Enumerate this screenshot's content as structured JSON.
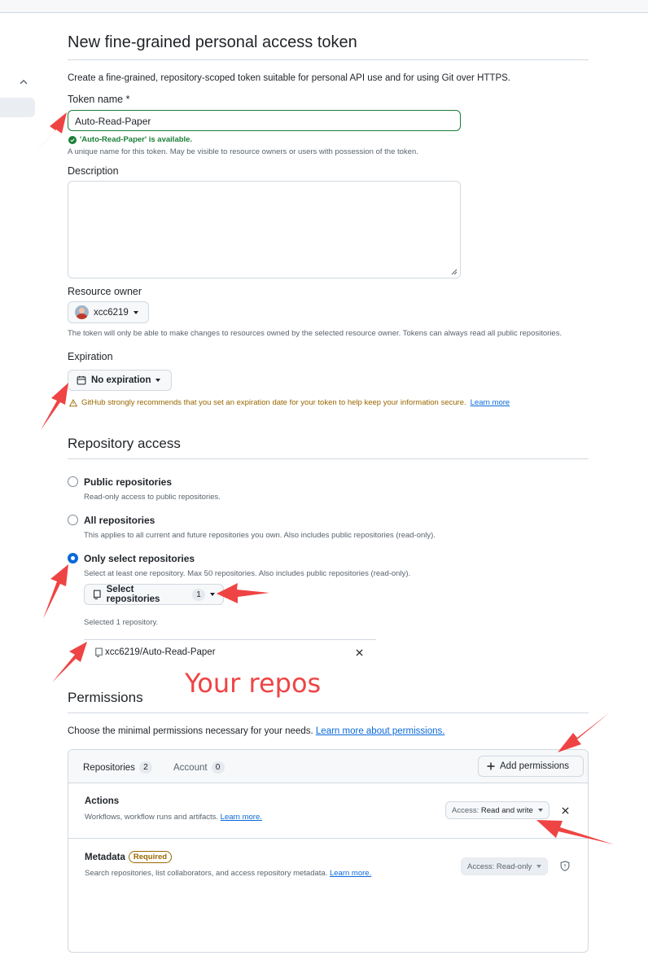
{
  "page": {
    "title": "New fine-grained personal access token",
    "intro": "Create a fine-grained, repository-scoped token suitable for personal API use and for using Git over HTTPS."
  },
  "token_name": {
    "label": "Token name *",
    "value": "Auto-Read-Paper",
    "availability": "'Auto-Read-Paper' is available.",
    "hint": "A unique name for this token. May be visible to resource owners or users with possession of the token."
  },
  "description": {
    "label": "Description",
    "value": ""
  },
  "resource_owner": {
    "label": "Resource owner",
    "value": "xcc6219",
    "hint": "The token will only be able to make changes to resources owned by the selected resource owner. Tokens can always read all public repositories."
  },
  "expiration": {
    "label": "Expiration",
    "value": "No expiration",
    "warning": "GitHub strongly recommends that you set an expiration date for your token to help keep your information secure.",
    "learn_more": "Learn more"
  },
  "repo_access": {
    "title": "Repository access",
    "options": [
      {
        "label": "Public repositories",
        "desc": "Read-only access to public repositories.",
        "selected": false
      },
      {
        "label": "All repositories",
        "desc": "This applies to all current and future repositories you own. Also includes public repositories (read-only).",
        "selected": false
      },
      {
        "label": "Only select repositories",
        "desc": "Select at least one repository. Max 50 repositories. Also includes public repositories (read-only).",
        "selected": true
      }
    ],
    "select_button": "Select repositories",
    "select_count": "1",
    "selected_text": "Selected 1 repository.",
    "selected_repos": [
      "xcc6219/Auto-Read-Paper"
    ]
  },
  "permissions": {
    "title": "Permissions",
    "intro": "Choose the minimal permissions necessary for your needs.",
    "learn_more": "Learn more about permissions.",
    "tabs": [
      {
        "label": "Repositories",
        "count": "2"
      },
      {
        "label": "Account",
        "count": "0"
      }
    ],
    "add_button": "Add permissions",
    "rows": [
      {
        "name": "Actions",
        "desc": "Workflows, workflow runs and artifacts.",
        "link": "Learn more.",
        "access_key": "Access:",
        "access_value": "Read and write",
        "required": ""
      },
      {
        "name": "Metadata",
        "desc": "Search repositories, list collaborators, and access repository metadata.",
        "link": "Learn more.",
        "access_key": "Access:",
        "access_value": "Read-only",
        "required": "Required"
      }
    ]
  },
  "annotation": {
    "text": "Your repos",
    "color": "#ef4444"
  },
  "colors": {
    "link": "#0969da",
    "success": "#1a7f37",
    "attention": "#9a6700",
    "radio_selected": "#0969da"
  }
}
